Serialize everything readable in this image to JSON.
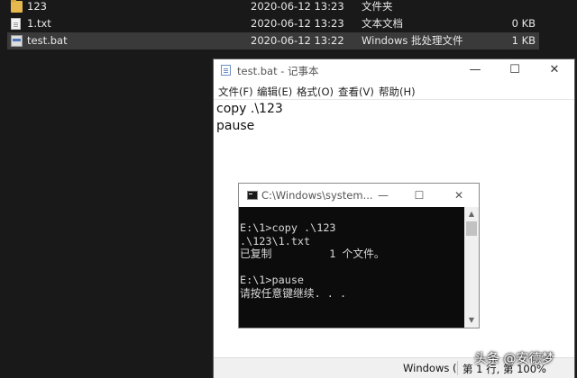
{
  "explorer": {
    "files": [
      {
        "name": "123",
        "date": "2020-06-12 13:23",
        "type": "文件夹",
        "size": "",
        "icon": "folder-icon",
        "selected": false
      },
      {
        "name": "1.txt",
        "date": "2020-06-12 13:23",
        "type": "文本文档",
        "size": "0 KB",
        "icon": "text-file-icon",
        "selected": false
      },
      {
        "name": "test.bat",
        "date": "2020-06-12 13:22",
        "type": "Windows 批处理文件",
        "size": "1 KB",
        "icon": "batch-file-icon",
        "selected": true
      }
    ]
  },
  "notepad": {
    "title": "test.bat - 记事本",
    "menus": [
      "文件(F)",
      "编辑(E)",
      "格式(O)",
      "查看(V)",
      "帮助(H)"
    ],
    "content": "copy .\\123\npause",
    "status_encoding": "Windows (",
    "status_position": "第 1 行, 第 100%",
    "controls": {
      "minimize": "—",
      "maximize": "☐",
      "close": "✕"
    }
  },
  "console": {
    "title": "C:\\Windows\\system...",
    "output": "E:\\1>copy .\\123\n.\\123\\1.txt\n已复制         1 个文件。\n\nE:\\1>pause\n请按任意键继续. . .",
    "controls": {
      "minimize": "—",
      "maximize": "☐",
      "close": "✕"
    }
  },
  "watermark": "头条 @安德梦",
  "colors": {
    "explorer_bg": "#191919",
    "selection_bg": "#3a3a3a",
    "console_bg": "#0c0c0c"
  }
}
